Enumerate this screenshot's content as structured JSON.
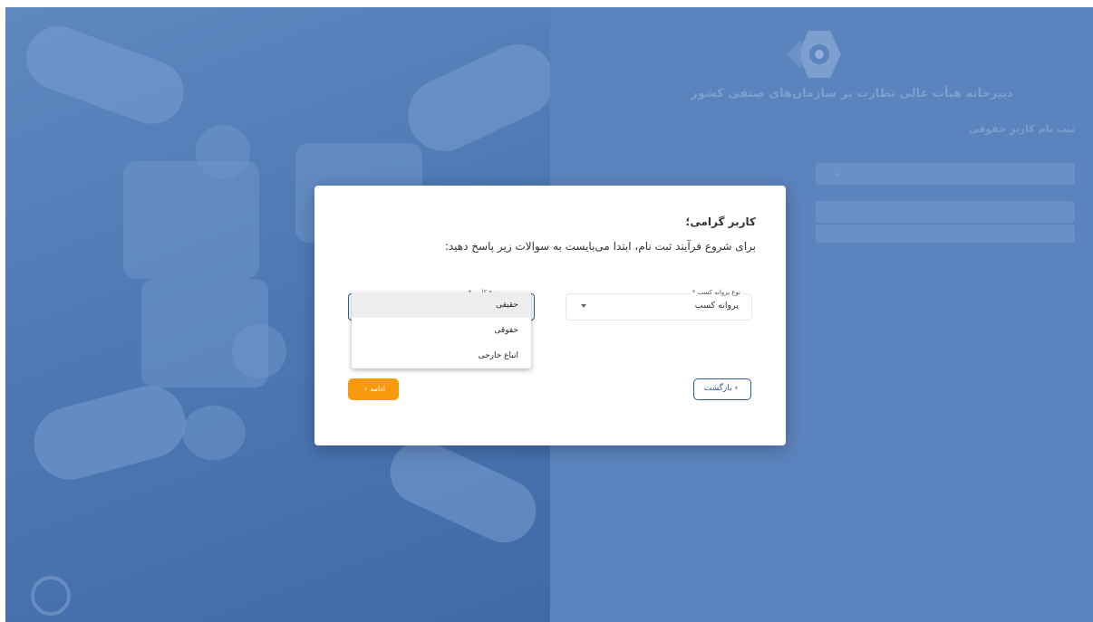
{
  "background": {
    "org_title": "دبیرخانه هیأت عالی نظارت بر سازمان‌های صنفی کشور",
    "form_title": "ثبت نام کاربر حقوقی"
  },
  "dialog": {
    "greeting": "کاربر گرامی؛",
    "instruction": "برای شروع فرآیند ثبت نام، ابتدا می‌بایست به سوالات زیر پاسخ دهید:",
    "license_type": {
      "label": "نوع پروانه کسب *",
      "value": "پروانه کسب"
    },
    "person_type": {
      "label": "نوع کاربر *",
      "options": [
        "حقیقی",
        "حقوقی",
        "اتباع خارجی"
      ],
      "highlighted": "حقیقی"
    },
    "back_button": "بازگشت",
    "continue_button": "ادامه"
  },
  "colors": {
    "primary": "#2d5a9a",
    "accent": "#f79a0e",
    "overlay": "#5b83bd"
  },
  "icons": {
    "back": "chevron-right-icon",
    "continue": "chevron-left-icon",
    "dropdown": "caret-down-icon"
  }
}
